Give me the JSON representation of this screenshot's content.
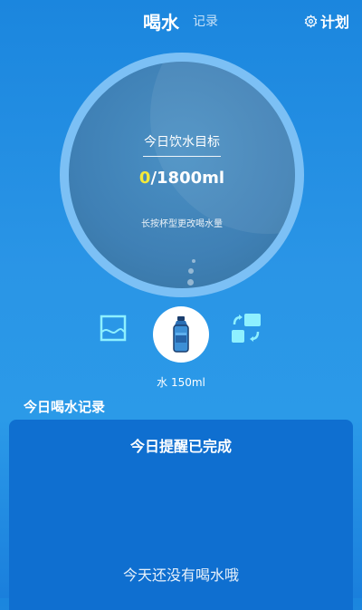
{
  "header": {
    "active_tab": "喝水",
    "secondary_tab": "记录",
    "plan_label": "计划"
  },
  "goal": {
    "label": "今日饮水目标",
    "current": "0",
    "total": "/1800ml",
    "hint": "长按杯型更改喝水量"
  },
  "cup": {
    "label": "水 150ml",
    "icon": "water-bottle-icon"
  },
  "record": {
    "title": "今日喝水记录",
    "status": "今日提醒已完成",
    "empty_text": "今天还没有喝水哦"
  },
  "colors": {
    "accent": "#f3e83a",
    "icon_cyan": "#8ef0ff",
    "background": "#1b86de"
  }
}
